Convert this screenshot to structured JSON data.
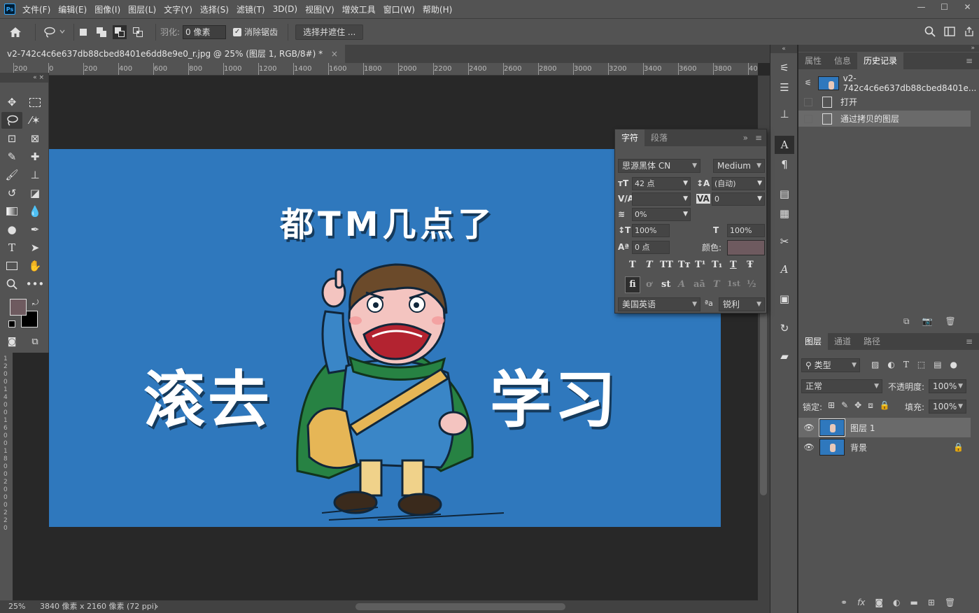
{
  "app": {
    "logo": "Ps"
  },
  "menu": [
    "文件(F)",
    "编辑(E)",
    "图像(I)",
    "图层(L)",
    "文字(Y)",
    "选择(S)",
    "滤镜(T)",
    "3D(D)",
    "视图(V)",
    "增效工具",
    "窗口(W)",
    "帮助(H)"
  ],
  "window_controls": {
    "minimize": "—",
    "maximize": "☐",
    "close": "✕"
  },
  "options": {
    "feather_label": "羽化:",
    "feather_value": "0 像素",
    "antialias_label": "消除锯齿",
    "antialias_checked": true,
    "select_mask_label": "选择并遮住 ..."
  },
  "document": {
    "tab_title": "v2-742c4c6e637db88cbed8401e6dd8e9e0_r.jpg @ 25% (图层 1, RGB/8#) *",
    "tab_close": "×"
  },
  "ruler": {
    "top_labels": [
      "200",
      "0",
      "200",
      "400",
      "600",
      "800",
      "1000",
      "1200",
      "1400",
      "1600",
      "1800",
      "2000",
      "2200",
      "2400",
      "2600",
      "2800",
      "3000",
      "3200",
      "3400",
      "3600",
      "3800",
      "40"
    ],
    "left_labels": [
      "1",
      "2",
      "0",
      "0",
      "1",
      "4",
      "0",
      "0",
      "1",
      "6",
      "0",
      "0",
      "1",
      "8",
      "0",
      "0",
      "2",
      "0",
      "0",
      "0",
      "2",
      "2",
      "0"
    ]
  },
  "canvas_image": {
    "background": "#2f78bd",
    "title_text": "都TM几点了",
    "left_text": "滚去",
    "right_text": "学习"
  },
  "colors": {
    "foreground": "#6e5a5f",
    "background": "#000000",
    "char_color": "#6e5a5f"
  },
  "statusbar": {
    "zoom": "25%",
    "doc_info": "3840 像素 x 2160 像素 (72 ppi)",
    "arrow": "›"
  },
  "history_panel": {
    "tabs": [
      "属性",
      "信息",
      "历史记录"
    ],
    "active_tab": "历史记录",
    "snapshot": "v2-742c4c6e637db88cbed8401e...",
    "items": [
      "打开",
      "通过拷贝的图层"
    ]
  },
  "character_panel": {
    "tabs": [
      "字符",
      "段落"
    ],
    "font_family": "思源黑体 CN",
    "font_style": "Medium",
    "size": "42 点",
    "leading": "(自动)",
    "kerning": "",
    "tracking": "0",
    "tsume": "0%",
    "vscale": "100%",
    "hscale": "100%",
    "baseline": "0 点",
    "color_label": "颜色:",
    "style_buttons": [
      "T",
      "T",
      "TT",
      "Tт",
      "T¹",
      "T₁",
      "T",
      "Ŧ"
    ],
    "opentype_buttons": [
      "fi",
      "ơ",
      "st",
      "A",
      "aā",
      "T",
      "1st",
      "½"
    ],
    "language": "美国英语",
    "aa_icon": "ªa",
    "antialias": "锐利"
  },
  "layers_panel": {
    "tabs": [
      "图层",
      "通道",
      "路径"
    ],
    "filter_label": "类型",
    "blend_mode": "正常",
    "opacity_label": "不透明度:",
    "opacity": "100%",
    "lock_label": "锁定:",
    "fill_label": "填充:",
    "fill": "100%",
    "layers": [
      {
        "name": "图层 1",
        "selected": true,
        "locked": false
      },
      {
        "name": "背景",
        "selected": false,
        "locked": true
      }
    ]
  }
}
